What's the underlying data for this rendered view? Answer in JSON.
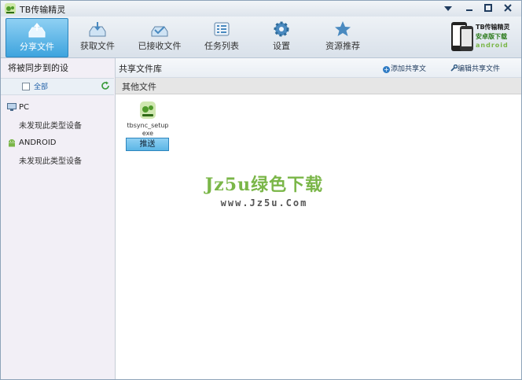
{
  "window": {
    "title": "TB传输精灵"
  },
  "toolbar": {
    "items": [
      {
        "label": "分享文件",
        "icon": "share-tray-icon",
        "active": true
      },
      {
        "label": "获取文件",
        "icon": "download-tray-icon"
      },
      {
        "label": "已接收文件",
        "icon": "inbox-tray-icon"
      },
      {
        "label": "任务列表",
        "icon": "list-icon"
      },
      {
        "label": "设置",
        "icon": "gear-icon"
      },
      {
        "label": "资源推荐",
        "icon": "star-icon"
      }
    ],
    "promo": {
      "line1": "TB传输精灵",
      "line2": "安卓版下载",
      "line3": "android"
    }
  },
  "left": {
    "header": "将被同步到的设",
    "select_all": "全部",
    "groups": [
      {
        "label": "PC",
        "empty": "未发现此类型设备",
        "icon": "pc-icon"
      },
      {
        "label": "ANDROID",
        "empty": "未发现此类型设备",
        "icon": "android-icon"
      }
    ]
  },
  "right": {
    "title": "共享文件库",
    "add_label": "添加共享文",
    "edit_label": "编辑共享文件",
    "section": "其他文件",
    "file": {
      "name_line1": "tbsync_setup",
      "name_line2": "exe",
      "icon": "android-app-icon"
    },
    "push_label": "推送"
  },
  "watermark": {
    "main": "Jz5u绿色下载",
    "sub": "www.Jz5u.Com"
  },
  "colors": {
    "accent": "#3ea4de",
    "link": "#1f5fa8",
    "watermark": "#7ab648"
  }
}
